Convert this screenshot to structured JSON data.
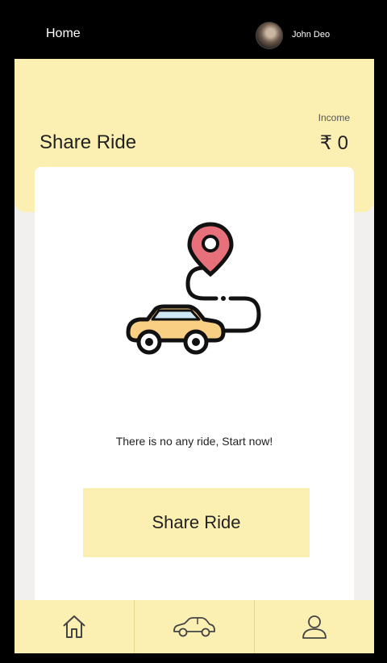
{
  "topbar": {
    "title": "Home",
    "user_name": "John Deo"
  },
  "header": {
    "title": "Share Ride",
    "income_label": "Income",
    "income_value": "₹ 0"
  },
  "empty_state": {
    "message": "There is no any ride, Start now!"
  },
  "actions": {
    "share_ride_label": "Share Ride"
  },
  "bottom_nav": {
    "items": [
      "home-icon",
      "car-icon",
      "user-icon"
    ]
  },
  "colors": {
    "accent": "#fbefb2",
    "pin": "#e8707a",
    "car_body": "#f9cf84",
    "car_window": "#cfe8f5"
  }
}
